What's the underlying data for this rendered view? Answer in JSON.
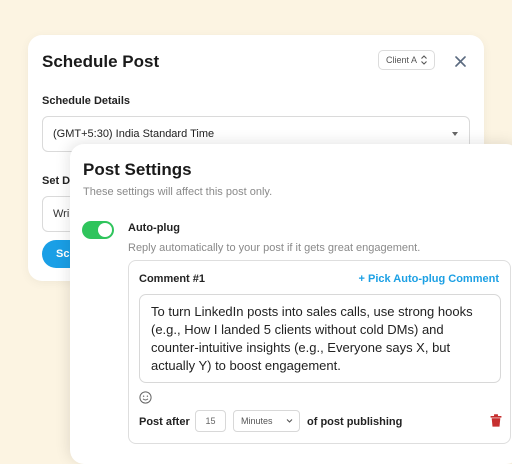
{
  "schedule": {
    "title": "Schedule Post",
    "client_select": "Client A",
    "details_label": "Schedule Details",
    "timezone": "(GMT+5:30) India Standard Time",
    "set_label_partial": "Set D",
    "input_partial": "Wri",
    "button_partial": "Sc"
  },
  "settings": {
    "title": "Post Settings",
    "subtitle": "These settings will affect this post only.",
    "autoplug": {
      "enabled": true,
      "label": "Auto-plug",
      "description": "Reply automatically to your post if it gets great engagement."
    },
    "comment": {
      "title": "Comment #1",
      "pick_link": "+ Pick Auto-plug Comment",
      "text": "To turn LinkedIn posts into sales calls, use strong hooks (e.g., How I landed 5 clients without cold DMs) and counter-intuitive insights (e.g., Everyone says X, but actually Y) to boost engagement.",
      "post_after_label": "Post after",
      "delay_value": "15",
      "delay_unit": "Minutes",
      "post_after_suffix": "of post publishing"
    }
  },
  "colors": {
    "background": "#fcf4e2",
    "accent_blue": "#1a9fe6",
    "toggle_green": "#2fc45c",
    "trash_red": "#c62f2f"
  },
  "icons": [
    "updown-chevron-icon",
    "close-icon",
    "caret-down-icon",
    "emoji-icon",
    "chevron-down-icon",
    "trash-icon"
  ]
}
